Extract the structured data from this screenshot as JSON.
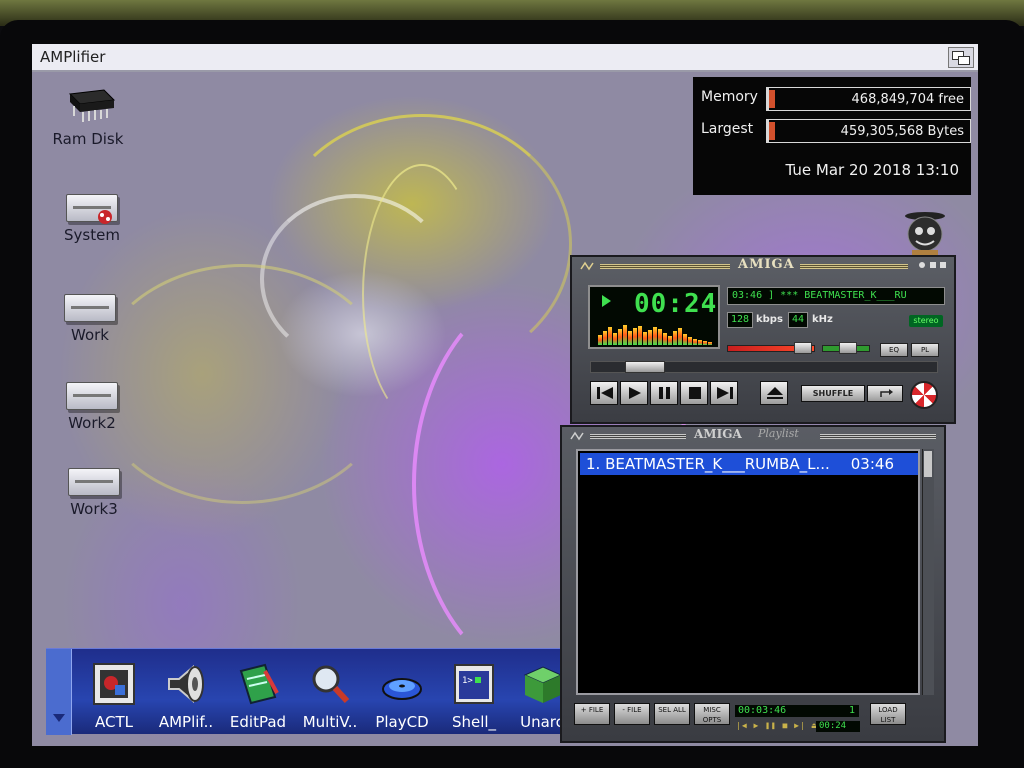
{
  "window": {
    "title": "AMPlifier"
  },
  "memory": {
    "memory_label": "Memory",
    "memory_value": "468,849,704 free",
    "largest_label": "Largest",
    "largest_value": "459,305,568 Bytes",
    "datetime": "Tue Mar 20 2018 13:10"
  },
  "desktop_icons": [
    {
      "label": "Ram Disk",
      "icon": "ram-chip-icon"
    },
    {
      "label": "System",
      "icon": "drive-icon"
    },
    {
      "label": "Work",
      "icon": "drive-icon"
    },
    {
      "label": "Work2",
      "icon": "drive-icon"
    },
    {
      "label": "Work3",
      "icon": "drive-icon"
    }
  ],
  "dock": {
    "items": [
      {
        "label": "ACTL",
        "icon": "actl-icon"
      },
      {
        "label": "AMPlif..",
        "icon": "speaker-icon"
      },
      {
        "label": "EditPad",
        "icon": "notepad-icon"
      },
      {
        "label": "MultiV..",
        "icon": "magnifier-icon"
      },
      {
        "label": "PlayCD",
        "icon": "cd-icon"
      },
      {
        "label": "Shell_",
        "icon": "shell-icon"
      },
      {
        "label": "Unarc",
        "icon": "box-icon"
      }
    ]
  },
  "player": {
    "logo": "AMIGA",
    "time": "00:24",
    "track_display": "03:46 ]  ***  BEATMASTER_K___RU",
    "bitrate": "128",
    "bitrate_unit": "kbps",
    "samplerate": "44",
    "samplerate_unit": "kHz",
    "stereo_label": "stereo",
    "eq_label": "EQ",
    "pl_label": "PL",
    "shuffle_label": "SHUFFLE",
    "accent_color": "#3fe04f"
  },
  "playlist": {
    "logo": "AMIGA",
    "logo_suffix": "Playlist",
    "tracks": [
      {
        "title": "1. BEATMASTER_K___RUMBA_L...",
        "duration": "03:46"
      }
    ],
    "buttons": {
      "add": "+ FILE",
      "remove": "- FILE",
      "sel": "SEL ALL",
      "misc": "MISC OPTS",
      "list": "LOAD LIST"
    },
    "total_time": "00:03:46",
    "count": "1",
    "elapsed": "00:24",
    "selection_color": "#1e4fd8"
  }
}
